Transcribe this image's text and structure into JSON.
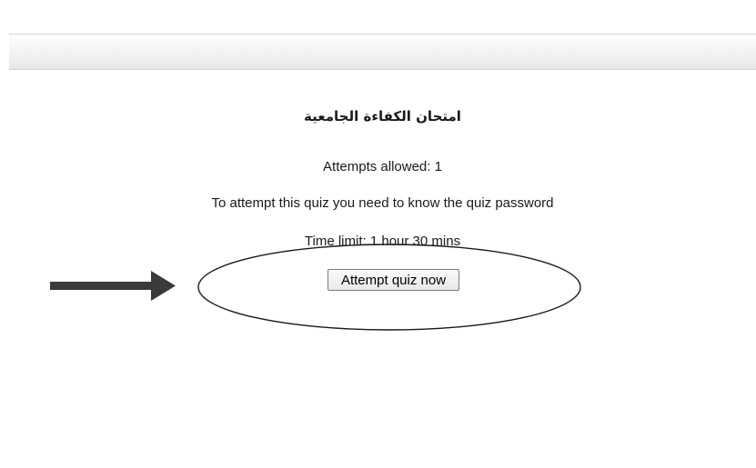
{
  "quiz": {
    "title": "امتحان الكفاءة الجامعية",
    "attempts_allowed": "Attempts allowed: 1",
    "password_note": "To attempt this quiz you need to know the quiz password",
    "time_limit": "Time limit: 1 hour 30 mins",
    "attempt_button_label": "Attempt quiz now"
  },
  "annotation": {
    "arrow_color": "#3a3a3a",
    "ellipse_color": "#1a1a1a",
    "arrow_icon": "right-arrow-icon",
    "highlight_shape": "ellipse"
  }
}
